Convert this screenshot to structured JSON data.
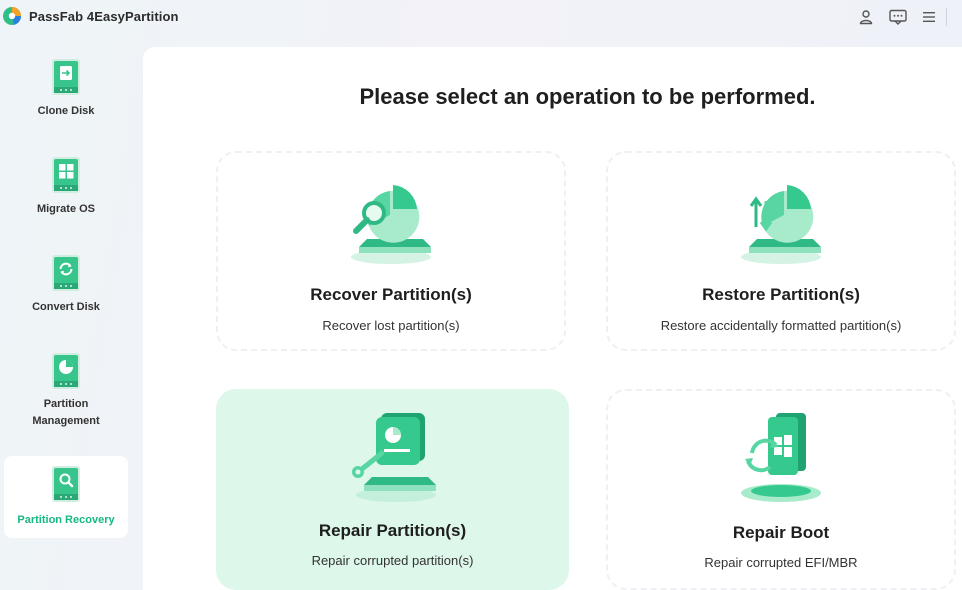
{
  "app": {
    "title": "PassFab 4EasyPartition"
  },
  "titlebar_icons": [
    "account-icon",
    "feedback-icon",
    "menu-icon"
  ],
  "sidebar": {
    "items": [
      {
        "label": "Clone Disk",
        "icon": "clone-disk-icon",
        "active": false
      },
      {
        "label": "Migrate OS",
        "icon": "migrate-os-icon",
        "active": false
      },
      {
        "label": "Convert Disk",
        "icon": "convert-disk-icon",
        "active": false
      },
      {
        "label": "Partition Management",
        "label_line1": "Partition",
        "label_line2": "Management",
        "icon": "partition-management-icon",
        "active": false
      },
      {
        "label": "Partition Recovery",
        "icon": "partition-recovery-icon",
        "active": true
      }
    ]
  },
  "main": {
    "title": "Please select an operation to be performed.",
    "cards": [
      {
        "title": "Recover Partition(s)",
        "desc": "Recover lost partition(s)",
        "icon": "recover-partition-icon"
      },
      {
        "title": "Restore Partition(s)",
        "desc": "Restore accidentally formatted partition(s)",
        "icon": "restore-partition-icon"
      },
      {
        "title": "Repair Partition(s)",
        "desc": "Repair corrupted partition(s)",
        "icon": "repair-partition-icon",
        "highlighted": true
      },
      {
        "title": "Repair Boot",
        "desc": "Repair corrupted EFI/MBR",
        "icon": "repair-boot-icon"
      }
    ]
  },
  "colors": {
    "accent": "#16b980",
    "illustration_green": "#34c98d",
    "highlight_bg": "#ddf7ea"
  }
}
